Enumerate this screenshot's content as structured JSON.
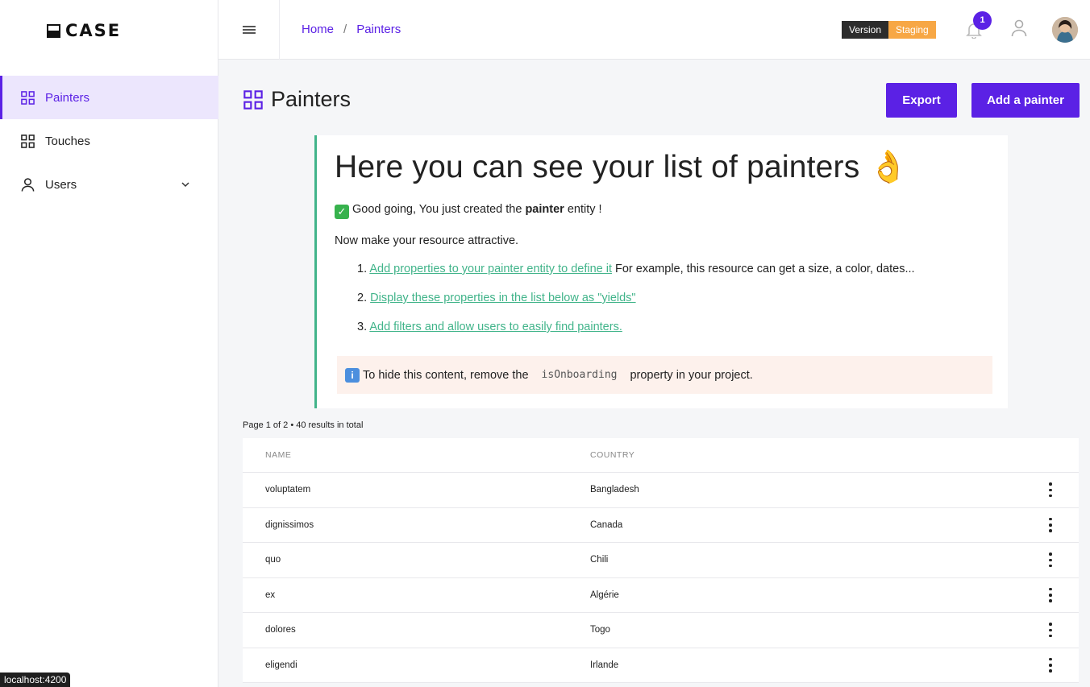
{
  "app": {
    "logo_text": "CASE"
  },
  "sidebar": {
    "items": [
      {
        "label": "Painters",
        "icon": "grid-icon",
        "active": true
      },
      {
        "label": "Touches",
        "icon": "grid-icon",
        "active": false
      },
      {
        "label": "Users",
        "icon": "user-icon",
        "active": false,
        "expandable": true
      }
    ]
  },
  "header": {
    "breadcrumb": [
      "Home",
      "Painters"
    ],
    "breadcrumb_separator": "/",
    "version_label": "Version",
    "version_env": "Staging",
    "notification_count": "1"
  },
  "page": {
    "title": "Painters",
    "export_label": "Export",
    "add_label": "Add a painter"
  },
  "onboarding": {
    "heading": "Here you can see your list of painters 👌",
    "created_prefix": "Good going, You just created the ",
    "created_entity": "painter",
    "created_suffix": " entity !",
    "intro": "Now make your resource attractive.",
    "steps": [
      {
        "num": "1.",
        "link": "Add properties to your painter entity to define it",
        "after": " For example, this resource can get a size, a color, dates..."
      },
      {
        "num": "2.",
        "link": "Display these properties in the list below as \"yields\"",
        "after": ""
      },
      {
        "num": "3.",
        "link": "Add filters and allow users to easily find painters.",
        "after": ""
      }
    ],
    "hide_prefix": "To hide this content, remove the",
    "hide_code": "isOnboarding",
    "hide_suffix": "property in your project."
  },
  "table": {
    "results_text": "Page 1 of 2 • 40 results in total",
    "columns": [
      "NAME",
      "COUNTRY"
    ],
    "rows": [
      {
        "name": "voluptatem",
        "country": "Bangladesh"
      },
      {
        "name": "dignissimos",
        "country": "Canada"
      },
      {
        "name": "quo",
        "country": "Chili"
      },
      {
        "name": "ex",
        "country": "Algérie"
      },
      {
        "name": "dolores",
        "country": "Togo"
      },
      {
        "name": "eligendi",
        "country": "Irlande"
      }
    ]
  },
  "statusbar": {
    "url": "localhost:4200"
  },
  "colors": {
    "accent": "#5b21e5",
    "success": "#41b48a",
    "staging": "#f7a745"
  }
}
